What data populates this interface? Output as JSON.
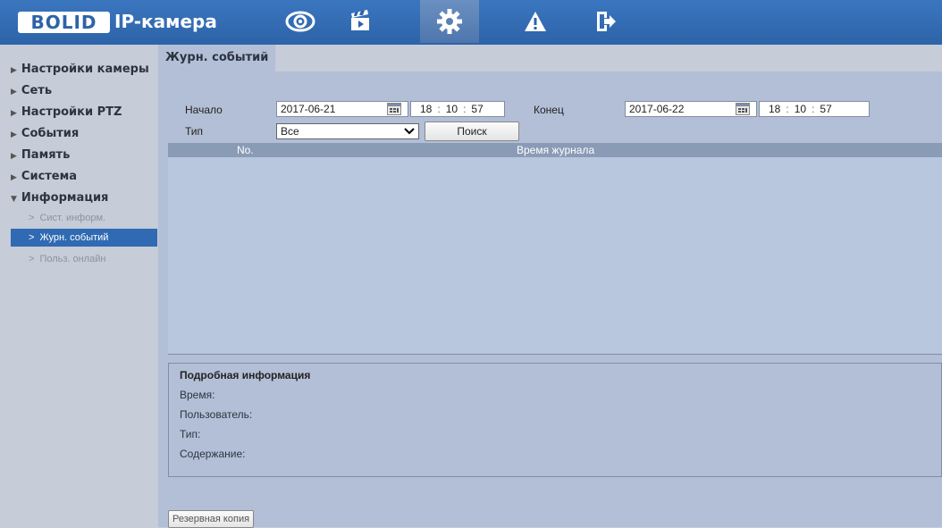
{
  "header": {
    "logo": "BOLID",
    "title": "IP-камера",
    "nav": [
      {
        "icon": "eye-icon",
        "active": false
      },
      {
        "icon": "clapperboard-icon",
        "active": false
      },
      {
        "icon": "gear-icon",
        "active": true
      },
      {
        "icon": "warning-icon",
        "active": false
      },
      {
        "icon": "logout-icon",
        "active": false
      }
    ]
  },
  "sidebar": {
    "items": [
      {
        "label": "Настройки камеры",
        "expanded": false
      },
      {
        "label": "Сеть",
        "expanded": false
      },
      {
        "label": "Настройки PTZ",
        "expanded": false
      },
      {
        "label": "События",
        "expanded": false
      },
      {
        "label": "Память",
        "expanded": false
      },
      {
        "label": "Система",
        "expanded": false
      },
      {
        "label": "Информация",
        "expanded": true
      }
    ],
    "sub_items": [
      {
        "label": "Сист. информ.",
        "active": false
      },
      {
        "label": "Журн. событий",
        "active": true
      },
      {
        "label": "Польз. онлайн",
        "active": false
      }
    ]
  },
  "main": {
    "tab": "Журн. событий",
    "start_label": "Начало",
    "start_date": "2017-06-21",
    "start_time": {
      "h": "18",
      "m": "10",
      "s": "57"
    },
    "end_label": "Конец",
    "end_date": "2017-06-22",
    "end_time": {
      "h": "18",
      "m": "10",
      "s": "57"
    },
    "type_label": "Тип",
    "type_value": "Все",
    "search_label": "Поиск",
    "table": {
      "col_no": "No.",
      "col_time": "Время журнала"
    },
    "detail": {
      "title": "Подробная информация",
      "time": "Время:",
      "user": "Пользователь:",
      "type": "Тип:",
      "content": "Содержание:"
    },
    "backup_label": "Резервная копия"
  },
  "colors": {
    "header": "#2d63a8",
    "active_sub": "#2f6ab3",
    "table_head": "#8a9bb6"
  }
}
